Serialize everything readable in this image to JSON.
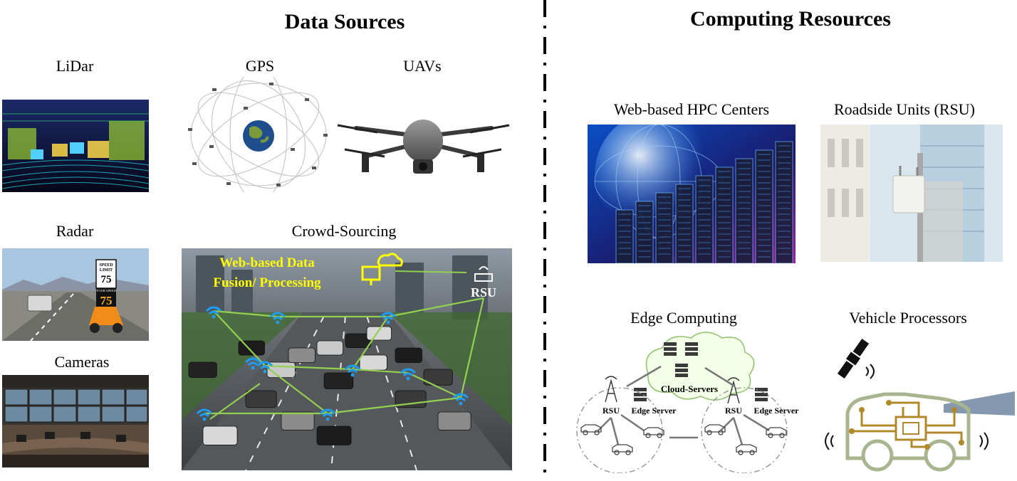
{
  "left_section": {
    "title": "Data Sources",
    "items": {
      "lidar": "LiDar",
      "gps": "GPS",
      "uavs": "UAVs",
      "radar": "Radar",
      "crowd": "Crowd-Sourcing",
      "cameras": "Cameras"
    },
    "radar_sign": {
      "line1": "SPEED",
      "line2": "LIMIT",
      "limit": "75",
      "your_speed": "YOUR SPEED",
      "speed": "75"
    },
    "crowd_overlay": {
      "line1": "Web-based Data",
      "line2": "Fusion/ Processing",
      "rsu": "RSU"
    }
  },
  "right_section": {
    "title": "Computing Resources",
    "items": {
      "hpc": "Web-based HPC Centers",
      "rsu": "Roadside Units (RSU)",
      "edge": "Edge Computing",
      "vehicle": "Vehicle Processors"
    },
    "edge_diagram": {
      "cloud_label": "Cloud-Servers",
      "rsu_left": "RSU",
      "edge_left": "Edge Server",
      "rsu_right": "RSU",
      "edge_right": "Edge Server"
    }
  },
  "colors": {
    "accent_green": "#92d050",
    "overlay_yellow": "#ffff00",
    "wifi_blue": "#1f9bef",
    "vehicle_outline": "#a9b58f",
    "circuit_gold": "#b08a2a",
    "beam_blue": "#8598b0"
  }
}
